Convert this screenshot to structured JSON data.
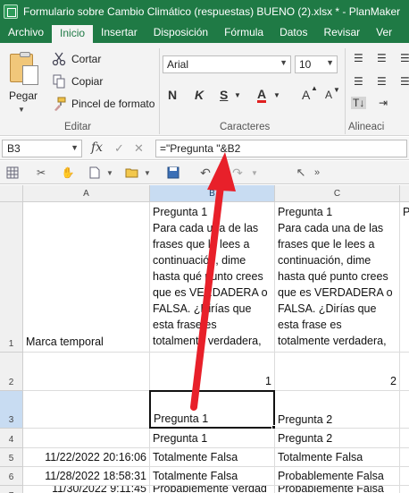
{
  "window": {
    "title": "Formulario sobre Cambio Climático (respuestas) BUENO (2).xlsx * - PlanMaker"
  },
  "menu": {
    "items": [
      "Archivo",
      "Inicio",
      "Insertar",
      "Disposición",
      "Fórmula",
      "Datos",
      "Revisar",
      "Ver"
    ],
    "active": "Inicio"
  },
  "ribbon": {
    "paste_label": "Pegar",
    "cut_label": "Cortar",
    "copy_label": "Copiar",
    "format_painter_label": "Pincel de formato",
    "edit_group_label": "Editar",
    "font_name": "Arial",
    "font_size": "10",
    "font_group_label": "Caracteres",
    "align_group_label": "Alineaci",
    "bold_label": "N",
    "italic_label": "K",
    "underline_label": "S",
    "fontcolor_label": "A",
    "grow_label": "A",
    "shrink_label": "A"
  },
  "formula_bar": {
    "cell_ref": "B3",
    "fx_label": "fx",
    "formula": "=\"Pregunta  \"&B2"
  },
  "grid": {
    "columns": [
      "A",
      "B",
      "C"
    ],
    "selected_column": "B",
    "rows": [
      {
        "num": "1",
        "a": "Marca temporal",
        "b": "Pregunta 1\nPara cada una de las frases que le lees a continuación, dime hasta qué punto crees que es VERDADERA o FALSA. ¿Dirías que esta frase es totalmente verdadera,",
        "c": "Pregunta 1\nPara cada una de las frases que le lees a continuación, dime hasta qué punto crees que es VERDADERA o FALSA. ¿Dirías que esta frase es totalmente verdadera,"
      },
      {
        "num": "2",
        "a": "",
        "b": "1",
        "c": "2"
      },
      {
        "num": "3",
        "a": "",
        "b": "Pregunta  1",
        "c": "Pregunta  2"
      },
      {
        "num": "4",
        "a": "",
        "b": "Pregunta  1",
        "c": "Pregunta  2"
      },
      {
        "num": "5",
        "a": "11/22/2022 20:16:06",
        "b": "Totalmente Falsa",
        "c": "Totalmente Falsa"
      },
      {
        "num": "6",
        "a": "11/28/2022 18:58:31",
        "b": "Totalmente Falsa",
        "c": "Probablemente Falsa"
      },
      {
        "num": "7",
        "a": "11/30/2022 9:11:45",
        "b": "Probablemente Verdad",
        "c": "Probablemente Falsa"
      }
    ],
    "overflow_col_d": "P"
  },
  "colors": {
    "title_green": "#1f7a45",
    "arrow_red": "#e8202a",
    "selection_blue": "#c8dcf2"
  },
  "icons": [
    "cut-icon",
    "copy-icon",
    "format-painter-icon",
    "save-icon",
    "undo-icon",
    "redo-icon",
    "open-icon",
    "new-icon",
    "cursor-icon"
  ]
}
